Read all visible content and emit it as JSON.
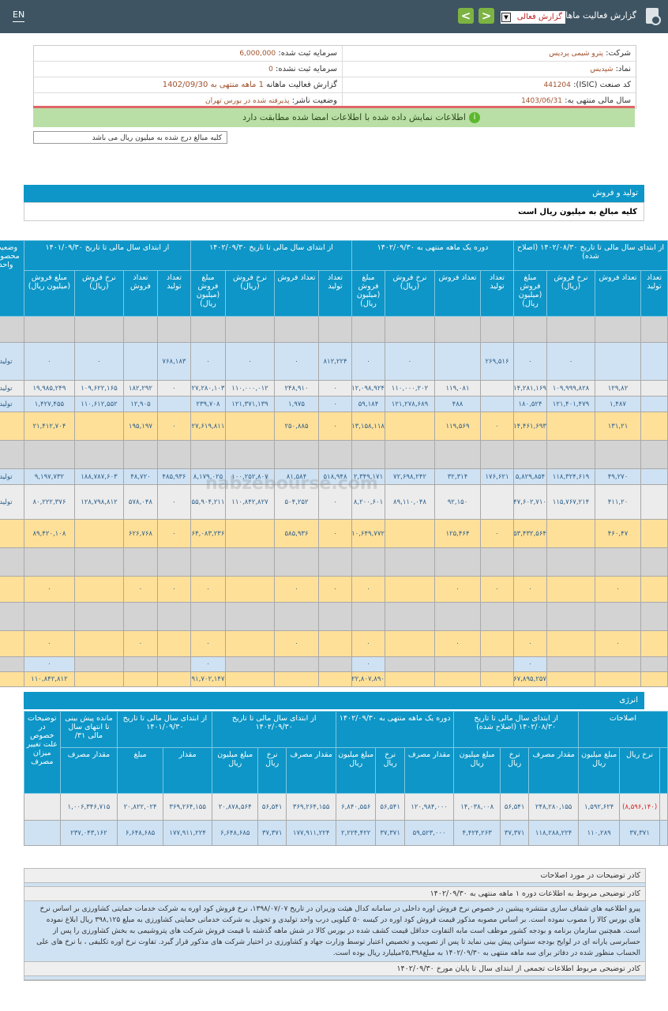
{
  "header": {
    "lang_toggle": "EN",
    "title": "گزارش فعالیت ماهانه",
    "report_select_value": "گزارش فعالی",
    "nav_prev": "<",
    "nav_next": ">"
  },
  "info": {
    "company_label": "شرکت:",
    "company_value": "پترو شیمی پردیس",
    "capital_label": "سرمایه ثبت شده:",
    "capital_value": "6,000,000",
    "symbol_label": "نماد:",
    "symbol_value": "شپدیس",
    "unregistered_label": "سرمایه ثبت نشده:",
    "unregistered_value": "0",
    "isic_label": "کد صنعت (ISIC):",
    "isic_value": "441204",
    "report_label": "گزارش فعالیت ماهانه",
    "report_value": "1 ماهه منتهی به 1402/09/30",
    "fiscal_label": "سال مالی منتهی به:",
    "fiscal_value": "1403/06/31",
    "status_label": "وضعیت ناشر:",
    "status_value": "پذیرفته شده در بورس تهران",
    "verified_message": "اطلاعات نمایش داده شده با اطلاعات امضا شده مطابقت دارد",
    "amounts_note": "کلیه مبالغ درج شده به میلیون ریال می باشد"
  },
  "production": {
    "section_title": "تولید و فروش",
    "subtitle": "کلیه مبالغ به میلیون ریال است",
    "groups": [
      "از ابتدای سال مالی تا تاریخ ۱۴۰۲/۰۸/۳۰ (اصلاح شده)",
      "دوره یک ماهه منتهی به ۱۴۰۲/۰۹/۳۰",
      "از ابتدای سال مالی تا تاریخ ۱۴۰۲/۰۹/۳۰",
      "از ابتدای سال مالی تا تاریخ ۱۴۰۱/۰۹/۳۰"
    ],
    "status_col": "وضعیت محصول-واحد",
    "subcols": [
      "تعداد تولید",
      "تعداد فروش",
      "نرخ فروش (ریال)",
      "مبلغ فروش (میلیون ریال)"
    ],
    "rows": [
      {
        "style": "gray",
        "unit": "",
        "cells": [
          "",
          "",
          "",
          "",
          "",
          "",
          "",
          "",
          "",
          "",
          "",
          "",
          "",
          "",
          "",
          ""
        ]
      },
      {
        "style": "blue",
        "unit": "تولید",
        "cells": [
          "",
          "",
          "۰",
          "۰",
          "۲۶۹,۵۱۶",
          "",
          "۰",
          "۰",
          "۸۱۲,۲۲۴",
          "۰",
          "۰",
          "۰",
          "۷۶۸,۱۸۳",
          "",
          "۰",
          "۰"
        ]
      },
      {
        "style": "light",
        "unit": "تولید",
        "cells": [
          "",
          "۱۲۹,۸۲",
          "۱۰۹,۹۹۹,۸۲۸",
          "۱۴,۲۸۱,۱۶۹",
          "",
          "۱۱۹,۰۸۱",
          "۱۱۰,۰۰۰,۲۰۲",
          "۱۲,۰۹۸,۹۲۴",
          "۰",
          "۲۴۸,۹۱۰",
          "۱۱۰,۰۰۰,۰۱۲",
          "۲۷,۲۸۰,۱۰۳",
          "۰",
          "۱۸۲,۲۹۲",
          "۱۰۹,۶۲۲,۱۶۵",
          "۱۹,۹۸۵,۲۴۹"
        ]
      },
      {
        "style": "blue",
        "unit": "تولید",
        "cells": [
          "",
          "۱,۴۸۷",
          "۱۲۱,۴۰۱,۴۷۹",
          "۱۸۰,۵۲۴",
          "",
          "۴۸۸",
          "۱۲۱,۲۷۸,۶۸۹",
          "۵۹,۱۸۴",
          "۰",
          "۱,۹۷۵",
          "۱۲۱,۳۷۱,۱۳۹",
          "۲۳۹,۷۰۸",
          "",
          "۱۲,۹۰۵",
          "۱۱۰,۶۱۲,۵۵۲",
          "۱,۴۲۷,۴۵۵"
        ]
      },
      {
        "style": "yellow",
        "unit": "",
        "cells": [
          "",
          "۱۳۱,۲۱",
          "",
          "۱۴,۴۶۱,۶۹۳",
          "۰",
          "۱۱۹,۵۶۹",
          "",
          "۱۳,۱۵۸,۱۱۸",
          "۰",
          "۲۵۰,۸۸۵",
          "",
          "۲۷,۶۱۹,۸۱۱",
          "۰",
          "۱۹۵,۱۹۷",
          "",
          "۲۱,۴۱۲,۷۰۴"
        ]
      },
      {
        "style": "gray",
        "unit": "",
        "cells": [
          "",
          "",
          "",
          "",
          "",
          "",
          "",
          "",
          "",
          "",
          "",
          "",
          "",
          "",
          "",
          ""
        ]
      },
      {
        "style": "blue",
        "unit": "تولید",
        "cells": [
          "",
          "۴۹,۲۷۰",
          "۱۱۸,۳۲۴,۶۱۹",
          "۵,۸۲۹,۸۵۴",
          "۱۷۶,۶۲۱",
          "۳۲,۳۱۴",
          "۷۲,۶۹۸,۲۴۲",
          "۲,۳۴۹,۱۷۱",
          "۵۱۸,۹۴۸",
          "۸۱,۵۸۴",
          "۱۰۰,۲۵۲,۸۰۷",
          "۸,۱۷۹,۰۲۵",
          "۴۸۵,۹۳۶",
          "۴۸,۷۲۰",
          "۱۸۸,۷۸۷,۶۰۳",
          "۹,۱۹۷,۷۳۲"
        ]
      },
      {
        "style": "light",
        "unit": "تولید",
        "cells": [
          "",
          "۴۱۱,۲۰",
          "۱۱۵,۷۶۷,۲۱۴",
          "۴۷,۶۰۲,۷۱۰",
          "",
          "۹۲,۱۵۰",
          "۸۹,۱۱۰,۰۴۸",
          "۸,۲۰۰,۶۰۱",
          "۰",
          "۵۰۴,۲۵۲",
          "۱۱۰,۸۴۲,۸۲۷",
          "۵۵,۹۰۴,۲۱۱",
          "۰",
          "۵۷۸,۰۴۸",
          "۱۲۸,۷۹۸,۸۱۲",
          "۸۰,۲۲۲,۳۷۶"
        ]
      },
      {
        "style": "yellow",
        "unit": "",
        "cells": [
          "",
          "۴۶۰,۴۷",
          "",
          "۵۳,۴۳۲,۵۶۴",
          "۰",
          "۱۲۵,۴۶۴",
          "",
          "۱۰,۶۴۹,۷۷۲",
          "۰",
          "۵۸۵,۹۳۶",
          "",
          "۶۴,۰۸۳,۲۳۶",
          "۰",
          "۶۲۶,۷۶۸",
          "",
          "۸۹,۴۲۰,۱۰۸"
        ]
      },
      {
        "style": "gray",
        "unit": "",
        "cells": [
          "",
          "",
          "",
          "",
          "",
          "",
          "",
          "",
          "",
          "",
          "",
          "",
          "",
          "",
          "",
          ""
        ]
      },
      {
        "style": "yellow",
        "unit": "",
        "cells": [
          "",
          "۰",
          "",
          "۰",
          "۰",
          "۰",
          "",
          "۰",
          "۰",
          "۰",
          "",
          "۰",
          "۰",
          "۰",
          "",
          "۰"
        ]
      },
      {
        "style": "gray",
        "unit": "",
        "cells": [
          "",
          "",
          "",
          "",
          "",
          "",
          "",
          "",
          "",
          "",
          "",
          "",
          "",
          "",
          "",
          ""
        ]
      },
      {
        "style": "yellow",
        "unit": "",
        "cells": [
          "",
          "۰",
          "",
          "۰",
          "",
          "۰",
          "",
          "۰",
          "",
          "۰",
          "",
          "۰",
          "",
          "۰",
          "",
          "۰"
        ]
      },
      {
        "style": "mixed",
        "unit": "",
        "cells": [
          "",
          "",
          "",
          "۰",
          "",
          "",
          "",
          "۰",
          "",
          "",
          "",
          "۰",
          "",
          "",
          "",
          "۰"
        ]
      },
      {
        "style": "yellow",
        "unit": "",
        "cells": [
          "",
          "",
          "",
          "۶۷,۸۹۵,۲۵۷",
          "",
          "",
          "",
          "۲۲,۸۰۷,۸۹۰",
          "",
          "",
          "",
          "۹۱,۷۰۲,۱۴۷",
          "",
          "",
          "",
          "۱۱۰,۸۴۲,۸۱۲"
        ]
      }
    ]
  },
  "energy": {
    "section_title": "انرژی",
    "groups": [
      "اصلاحات",
      "از ابتدای سال مالی تا تاریخ ۱۴۰۲/۰۸/۳۰ (اصلاح شده)",
      "دوره یک ماهه منتهی به ۱۴۰۲/۰۹/۳۰",
      "از ابتدای سال مالی تا تاریخ ۱۴۰۲/۰۹/۳۰",
      "از ابتدای سال مالی تا تاریخ ۱۴۰۱/۰۹/۳۰",
      "مانده پیش بینی تا انتهای سال مالی ۳۱/",
      "توضیحات در خصوص علت تغییر میزان مصرف"
    ],
    "subcols": {
      "corr": [
        "نرخ ریال",
        "مبلغ میلیون ریال"
      ],
      "std": [
        "مقدار مصرف",
        "نرخ ریال",
        "مبلغ میلیون ریال"
      ],
      "prev": [
        "مقدار",
        "مبلغ"
      ],
      "fc": [
        "مقدار مصرف"
      ]
    },
    "rows": [
      {
        "style": "light",
        "cells": [
          "(۸,۵۹۶,۱۴۰)",
          "۱,۵۹۲,۶۲۴",
          "۲۴۸,۲۸۰,۱۵۵",
          "۵۶,۵۴۱",
          "۱۴,۰۳۸,۰۰۸",
          "۱۲۰,۹۸۴,۰۰۰",
          "۵۶,۵۴۱",
          "۶,۸۴۰,۵۵۶",
          "۳۶۹,۲۶۴,۱۵۵",
          "۵۶,۵۴۱",
          "۲۰,۸۷۸,۵۶۴",
          "۳۶۹,۲۶۴,۱۵۵",
          "۲۰,۸۲۲,۰۲۴",
          "۱,۰۰۶,۳۴۶,۷۱۵",
          ""
        ]
      },
      {
        "style": "blue",
        "cells": [
          "۳۷,۳۷۱",
          "۱۱۰,۲۸۹",
          "۱۱۸,۲۸۸,۲۲۴",
          "۳۷,۳۷۱",
          "۴,۴۲۴,۲۶۳",
          "۵۹,۵۲۳,۰۰۰",
          "۳۷,۳۷۱",
          "۲,۲۲۴,۴۲۲",
          "۱۷۷,۹۱۱,۲۲۴",
          "۳۷,۳۷۱",
          "۶,۶۴۸,۶۸۵",
          "۱۷۷,۹۱۱,۲۲۴",
          "۶,۶۴۸,۶۸۵",
          "۲۳۷,۰۴۳,۱۶۲",
          ""
        ]
      }
    ]
  },
  "comments": {
    "corrections_title": "کادر توضیحات در مورد اصلاحات",
    "monthly_title": "کادر توضیحی مربوط به اطلاعات دوره ۱ ماهه منتهی به ۱۴۰۲/۰۹/۳۰",
    "monthly_text": "پیرو اطلاعیه های شفاف سازی منتشره پیشین در خصوص نرخ فروش اوره داخلی در سامانه کدال هیئت وزیران در تاریخ ۱۳۹۸/۰۷/۰۷، نرخ فروش کود اوره به شرکت خدمات حمایتی کشاورزی بر اساس نرخ های بورس کالا را مصوب نموده است. بر اساس مصوبه مذکور قیمت فروش کود اوره در کیسه ۵۰ کیلویی درب واحد تولیدی و تحویل به شرکت خدماتی حمایتی کشاورزی به مبلغ ۳۹۸,۱۲۵ ریال ابلاغ نموده است. همچنین سازمان برنامه و بودجه کشور موظف است مابه التفاوت حداقل قیمت کشف شده در بورس کالا در شش ماهه گذشته با قیمت فروش شرکت های پتروشیمی به بخش کشاورزی را پس از حسابرسی یارانه ای در لوایح بودجه سنواتی پیش بینی نماید تا پس از تصویب و تخصیص اعتبار توسط وزارت جهاد و کشاورزی در اختیار شرکت های مذکور قرار گیرد. تفاوت نرخ اوره تکلیفی ، با نرخ های علی الحساب منظور شده در دفاتر برای سه ماهه منتهی به ۱۴۰۲/۰۹/۳۰ به مبلغ۲۵,۳۹۸میلیارد ریال بوده است.",
    "cumulative_title": "کادر توضیحی مربوط اطلاعات تجمعی از ابتدای سال تا پایان مورخ ۱۴۰۲/۰۹/۳۰"
  },
  "watermark": "nabzebourse.com"
}
